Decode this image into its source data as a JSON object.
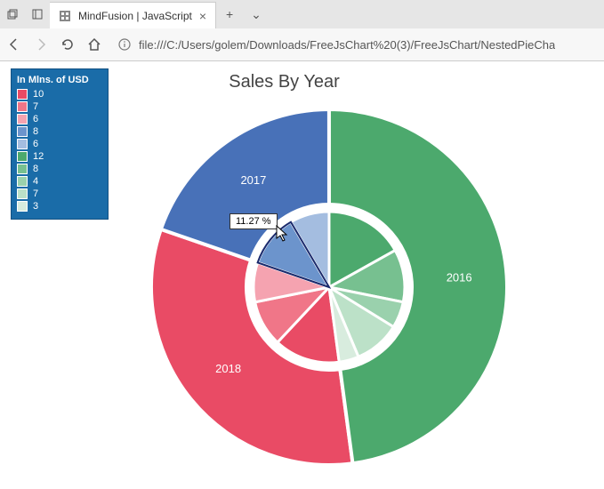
{
  "browser": {
    "tab_title": "MindFusion | JavaScript",
    "url": "file:///C:/Users/golem/Downloads/FreeJsChart%20(3)/FreeJsChart/NestedPieCha",
    "new_tab": "+",
    "close_tab": "×",
    "more": "⌄"
  },
  "chart": {
    "title": "Sales By Year",
    "tooltip": "11.27 %"
  },
  "legend": {
    "title": "In Mlns. of USD",
    "items": [
      {
        "label": "10",
        "color": "#e94b65"
      },
      {
        "label": "7",
        "color": "#f07688"
      },
      {
        "label": "6",
        "color": "#f5a3b0"
      },
      {
        "label": "8",
        "color": "#6c94cc"
      },
      {
        "label": "6",
        "color": "#a4bde0"
      },
      {
        "label": "12",
        "color": "#4ca96d"
      },
      {
        "label": "8",
        "color": "#77c090"
      },
      {
        "label": "4",
        "color": "#9ad1ad"
      },
      {
        "label": "7",
        "color": "#bce1c8"
      },
      {
        "label": "3",
        "color": "#d8ecde"
      }
    ]
  },
  "outer_ring": {
    "labels": {
      "y2016": "2016",
      "y2017": "2017",
      "y2018": "2018"
    }
  },
  "colors": {
    "red": "#e94b65",
    "blue": "#4871b8",
    "green": "#4ca96d",
    "white": "#ffffff"
  },
  "chart_data": {
    "type": "pie",
    "title": "Sales By Year",
    "unit": "Millions of USD",
    "outer_ring": [
      {
        "label": "2016",
        "value": 34,
        "color": "#4ca96d"
      },
      {
        "label": "2017",
        "value": 14,
        "color": "#4871b8"
      },
      {
        "label": "2018",
        "value": 23,
        "color": "#e94b65"
      }
    ],
    "inner_ring": [
      {
        "group": "2018",
        "value": 10,
        "color": "#e94b65"
      },
      {
        "group": "2018",
        "value": 7,
        "color": "#f07688"
      },
      {
        "group": "2018",
        "value": 6,
        "color": "#f5a3b0"
      },
      {
        "group": "2017",
        "value": 8,
        "color": "#6c94cc"
      },
      {
        "group": "2017",
        "value": 6,
        "color": "#a4bde0"
      },
      {
        "group": "2016",
        "value": 12,
        "color": "#4ca96d"
      },
      {
        "group": "2016",
        "value": 8,
        "color": "#77c090"
      },
      {
        "group": "2016",
        "value": 4,
        "color": "#9ad1ad"
      },
      {
        "group": "2016",
        "value": 7,
        "color": "#bce1c8"
      },
      {
        "group": "2016",
        "value": 3,
        "color": "#d8ecde"
      }
    ],
    "highlighted_slice": {
      "group": "2017",
      "value": 8,
      "percent": 11.27
    }
  }
}
